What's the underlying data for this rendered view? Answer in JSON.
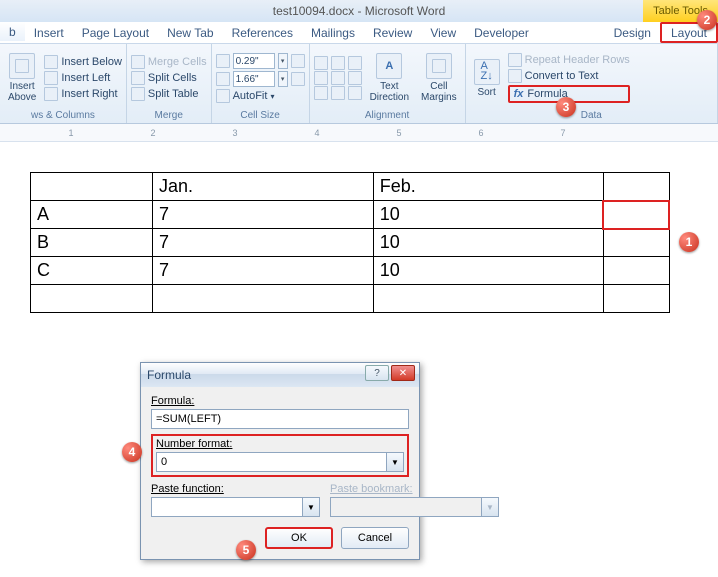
{
  "title": "test10094.docx - Microsoft Word",
  "contextual_tab": "Table Tools",
  "tabs": [
    "b",
    "Insert",
    "Page Layout",
    "New Tab",
    "References",
    "Mailings",
    "Review",
    "View",
    "Developer",
    "Design",
    "Layout"
  ],
  "ribbon": {
    "rows_cols": {
      "insert_above": "Insert\nAbove",
      "insert_below": "Insert Below",
      "insert_left": "Insert Left",
      "insert_right": "Insert Right",
      "label": "ws & Columns"
    },
    "merge": {
      "merge_cells": "Merge Cells",
      "split_cells": "Split Cells",
      "split_table": "Split Table",
      "label": "Merge"
    },
    "cell_size": {
      "height": "0.29\"",
      "width": "1.66\"",
      "autofit": "AutoFit",
      "label": "Cell Size"
    },
    "alignment": {
      "text_direction": "Text\nDirection",
      "cell_margins": "Cell\nMargins",
      "label": "Alignment"
    },
    "data": {
      "sort": "Sort",
      "repeat_header": "Repeat Header Rows",
      "convert": "Convert to Text",
      "formula": "Formula",
      "label": "Data"
    }
  },
  "ruler_marks": [
    "1",
    "2",
    "3",
    "4",
    "5",
    "6",
    "7"
  ],
  "table": {
    "headers": [
      "",
      "Jan.",
      "Feb.",
      ""
    ],
    "rows": [
      [
        "A",
        "7",
        "10",
        ""
      ],
      [
        "B",
        "7",
        "10",
        ""
      ],
      [
        "C",
        "7",
        "10",
        ""
      ],
      [
        "",
        "",
        "",
        ""
      ]
    ]
  },
  "dialog": {
    "title": "Formula",
    "formula_label": "Formula:",
    "formula_value": "=SUM(LEFT)",
    "number_format_label": "Number format:",
    "number_format_value": "0",
    "paste_function_label": "Paste function:",
    "paste_bookmark_label": "Paste bookmark:",
    "ok": "OK",
    "cancel": "Cancel"
  },
  "markers": {
    "1": "1",
    "2": "2",
    "3": "3",
    "4": "4",
    "5": "5"
  }
}
